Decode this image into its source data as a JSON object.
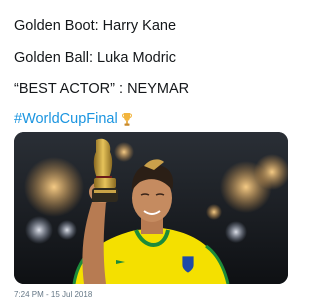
{
  "tweet": {
    "line1": "Golden Boot: Harry Kane",
    "line2": "Golden Ball: Luka Modric",
    "line3": "“BEST ACTOR” : NEYMAR",
    "hashtag": "#WorldCupFinal",
    "hashtag_emoji_icon": "trophy-icon",
    "timestamp": "7:24 PM - 15 Jul 2018"
  },
  "photo": {
    "subject": "player-holding-trophy",
    "colors": {
      "jersey": "#f4e000",
      "jersey_trim": "#1d8b3a",
      "background": "#1a1d22",
      "stadium_lights": "#e9a34b",
      "trophy": "#c9a447",
      "hashtag": "#1b95e0"
    }
  }
}
